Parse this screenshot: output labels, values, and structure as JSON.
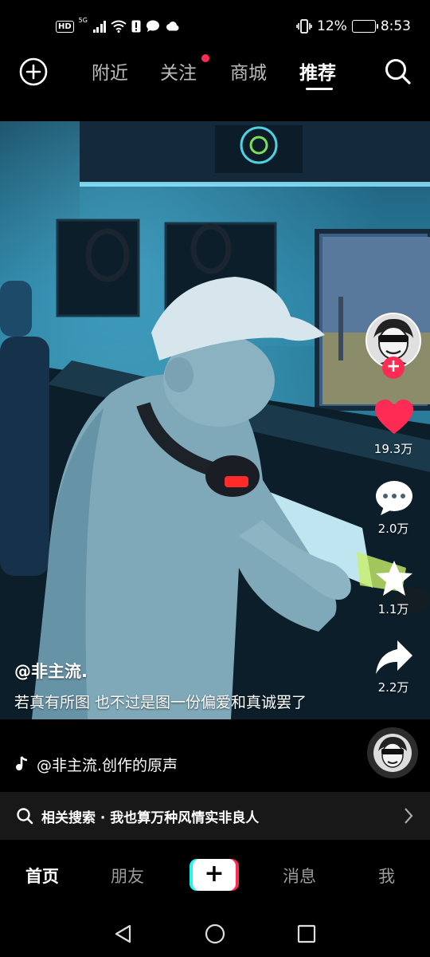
{
  "status_bar": {
    "network_badge": "HD",
    "network_type": "5G",
    "battery_percent": "12%",
    "battery_level": 0.12,
    "time": "8:53"
  },
  "top_nav": {
    "tabs": [
      {
        "label": "附近"
      },
      {
        "label": "关注"
      },
      {
        "label": "商城"
      },
      {
        "label": "推荐"
      }
    ],
    "active_tab": "推荐"
  },
  "video": {
    "likes": "19.3万",
    "comments": "2.0万",
    "favorites": "1.1万",
    "shares": "2.2万",
    "author": "@非主流.",
    "caption": "若真有所图 也不过是图一份偏爱和真诚罢了",
    "music": "@非主流.创作的原声"
  },
  "related_search": {
    "text": "相关搜索 · 我也算万种风情实非良人"
  },
  "bottom_nav": {
    "items": [
      {
        "label": "首页"
      },
      {
        "label": "朋友"
      },
      {
        "label": "消息"
      },
      {
        "label": "我"
      }
    ],
    "create_symbol": "+",
    "active_item": "首页"
  },
  "colors": {
    "accent_red": "#fe2c55",
    "accent_cyan": "#25f4ee",
    "battery": "#f0a020"
  }
}
